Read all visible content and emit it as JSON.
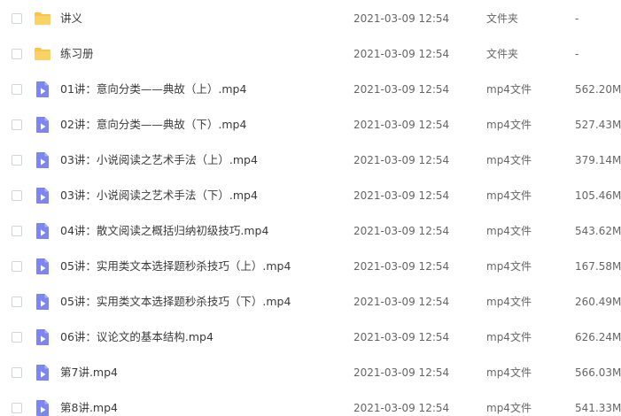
{
  "colors": {
    "folder": "#f9c544",
    "video": "#7b86f0",
    "checkbox_border": "#cfd3da"
  },
  "files": [
    {
      "name": "讲义",
      "date": "2021-03-09 12:54",
      "type": "文件夹",
      "size": "-",
      "icon": "folder-icon"
    },
    {
      "name": "练习册",
      "date": "2021-03-09 12:54",
      "type": "文件夹",
      "size": "-",
      "icon": "folder-icon"
    },
    {
      "name": "01讲：意向分类——典故（上）.mp4",
      "date": "2021-03-09 12:54",
      "type": "mp4文件",
      "size": "562.20M",
      "icon": "video-file-icon"
    },
    {
      "name": "02讲：意向分类——典故（下）.mp4",
      "date": "2021-03-09 12:54",
      "type": "mp4文件",
      "size": "527.43M",
      "icon": "video-file-icon"
    },
    {
      "name": "03讲：小说阅读之艺术手法（上）.mp4",
      "date": "2021-03-09 12:54",
      "type": "mp4文件",
      "size": "379.14M",
      "icon": "video-file-icon"
    },
    {
      "name": "03讲：小说阅读之艺术手法（下）.mp4",
      "date": "2021-03-09 12:54",
      "type": "mp4文件",
      "size": "105.46M",
      "icon": "video-file-icon"
    },
    {
      "name": "04讲：散文阅读之概括归纳初级技巧.mp4",
      "date": "2021-03-09 12:54",
      "type": "mp4文件",
      "size": "543.62M",
      "icon": "video-file-icon"
    },
    {
      "name": "05讲：实用类文本选择题秒杀技巧（上）.mp4",
      "date": "2021-03-09 12:54",
      "type": "mp4文件",
      "size": "167.58M",
      "icon": "video-file-icon"
    },
    {
      "name": "05讲：实用类文本选择题秒杀技巧（下）.mp4",
      "date": "2021-03-09 12:54",
      "type": "mp4文件",
      "size": "260.49M",
      "icon": "video-file-icon"
    },
    {
      "name": "06讲：议论文的基本结构.mp4",
      "date": "2021-03-09 12:54",
      "type": "mp4文件",
      "size": "626.24M",
      "icon": "video-file-icon"
    },
    {
      "name": "第7讲.mp4",
      "date": "2021-03-09 12:54",
      "type": "mp4文件",
      "size": "566.03M",
      "icon": "video-file-icon"
    },
    {
      "name": "第8讲.mp4",
      "date": "2021-03-09 12:54",
      "type": "mp4文件",
      "size": "541.33M",
      "icon": "video-file-icon"
    }
  ]
}
